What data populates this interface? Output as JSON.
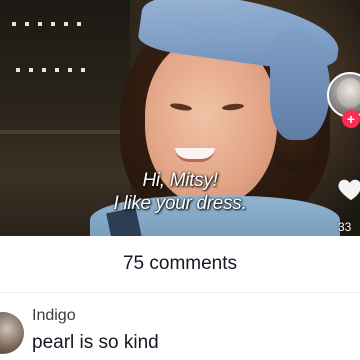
{
  "video": {
    "subtitle_line1": "Hi, Mitsy!",
    "subtitle_line2": "I like your dress.",
    "like_count": "33",
    "follow_symbol": "+"
  },
  "comments": {
    "count_label": "75 comments",
    "items": [
      {
        "username": "Indigo",
        "text": "pearl is so kind"
      }
    ]
  },
  "colors": {
    "follow_accent": "#fe2c55",
    "text_primary": "#161823"
  },
  "icons": [
    "heart-icon",
    "plus-icon"
  ]
}
